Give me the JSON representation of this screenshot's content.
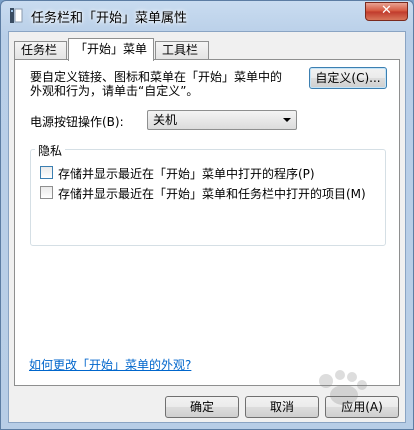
{
  "window": {
    "title": "任务栏和「开始」菜单属性",
    "close_label": "✕"
  },
  "tabs": [
    {
      "label": "任务栏"
    },
    {
      "label": "「开始」菜单"
    },
    {
      "label": "工具栏"
    }
  ],
  "panel": {
    "description_line1": "要自定义链接、图标和菜单在「开始」菜单中的",
    "description_line2": "外观和行为，请单击“自定义”。",
    "customize_button": "自定义(C)...",
    "power_label": "电源按钮操作(B):",
    "power_value": "关机",
    "privacy": {
      "title": "隐私",
      "options": [
        {
          "label": "存储并显示最近在「开始」菜单中打开的程序(P)",
          "checked": false
        },
        {
          "label": "存储并显示最近在「开始」菜单和任务栏中打开的项目(M)",
          "checked": false
        }
      ]
    },
    "help_link": "如何更改「开始」菜单的外观?"
  },
  "footer": {
    "ok": "确定",
    "cancel": "取消",
    "apply": "应用(A)"
  }
}
